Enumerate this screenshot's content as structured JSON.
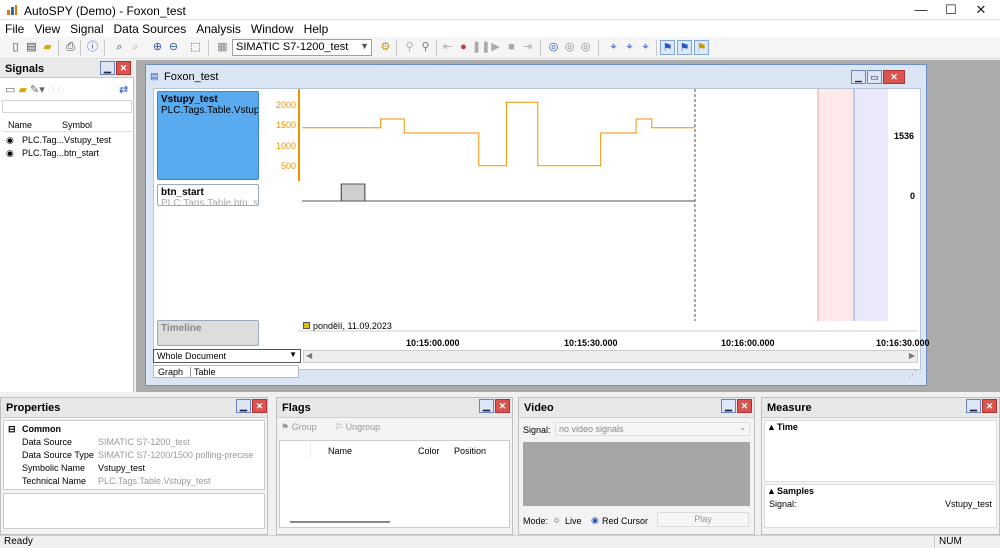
{
  "window": {
    "title": "AutoSPY (Demo) - Foxon_test",
    "minimize": "—",
    "maximize": "☐",
    "close": "✕"
  },
  "menu": [
    "File",
    "View",
    "Signal",
    "Data Sources",
    "Analysis",
    "Window",
    "Help"
  ],
  "toolbar": {
    "data_source": "SIMATIC S7-1200_test"
  },
  "signals_panel": {
    "title": "Signals",
    "col_name": "Name",
    "col_symbol": "Symbol",
    "rows": [
      {
        "name": "PLC.Tag...",
        "symbol": "Vstupy_test"
      },
      {
        "name": "PLC.Tag...",
        "symbol": "btn_start"
      }
    ]
  },
  "doc": {
    "title": "Foxon_test",
    "signals": [
      {
        "name": "Vstupy_test",
        "path": "PLC.Tags.Table.Vstupy_...",
        "value": "1536"
      },
      {
        "name": "btn_start",
        "path": "PLC.Tags.Table.btn_start",
        "value": "0"
      }
    ],
    "yticks": [
      "2000",
      "1500",
      "1000",
      "500"
    ],
    "timeline_label": "Timeline",
    "date_label": "pondělí, 11.09.2023",
    "time_ticks": [
      "10:15:00.000",
      "10:15:30.000",
      "10:16:00.000",
      "10:16:30.000"
    ],
    "zoom_select": "Whole Document",
    "tabs": [
      "Graph",
      "Table"
    ]
  },
  "chart_data": {
    "type": "line",
    "series": [
      {
        "name": "Vstupy_test",
        "x_pct": [
          0,
          20,
          20,
          26,
          26,
          45,
          45,
          52,
          52,
          60,
          60,
          76,
          76,
          85,
          85,
          89,
          89,
          100
        ],
        "values": [
          1536,
          1536,
          1800,
          1800,
          1380,
          1380,
          400,
          400,
          2300,
          2300,
          400,
          400,
          1380,
          1380,
          1800,
          1800,
          1536,
          1536
        ]
      },
      {
        "name": "btn_start",
        "x_pct": [
          0,
          10,
          10,
          16,
          16,
          100
        ],
        "values": [
          0,
          0,
          1,
          1,
          0,
          0
        ]
      }
    ],
    "ylim": [
      0,
      2400
    ]
  },
  "properties": {
    "title": "Properties",
    "group": "Common",
    "rows": [
      {
        "k": "Data Source",
        "v": "SIMATIC S7-1200_test",
        "dim": true
      },
      {
        "k": "Data Source Type",
        "v": "SIMATIC S7-1200/1500 polling-precise",
        "dim": true
      },
      {
        "k": "Symbolic Name",
        "v": "Vstupy_test",
        "dim": false
      },
      {
        "k": "Technical Name",
        "v": "PLC.Tags.Table.Vstupy_test",
        "dim": true
      }
    ]
  },
  "flags": {
    "title": "Flags",
    "group_btn": "Group",
    "ungroup_btn": "Ungroup",
    "cols": [
      "Name",
      "Color",
      "Position"
    ]
  },
  "video": {
    "title": "Video",
    "signal_label": "Signal:",
    "signal_value": "no video signals",
    "mode_label": "Mode:",
    "live": "Live",
    "red_cursor": "Red Cursor",
    "play": "Play"
  },
  "measure": {
    "title": "Measure",
    "time_label": "Time",
    "samples_label": "Samples",
    "signal_label": "Signal:",
    "signal_value": "Vstupy_test"
  },
  "status": {
    "left": "Ready",
    "right": "NUM"
  },
  "colors": {
    "accent": "#f29100",
    "selected": "#5aaaf0"
  }
}
